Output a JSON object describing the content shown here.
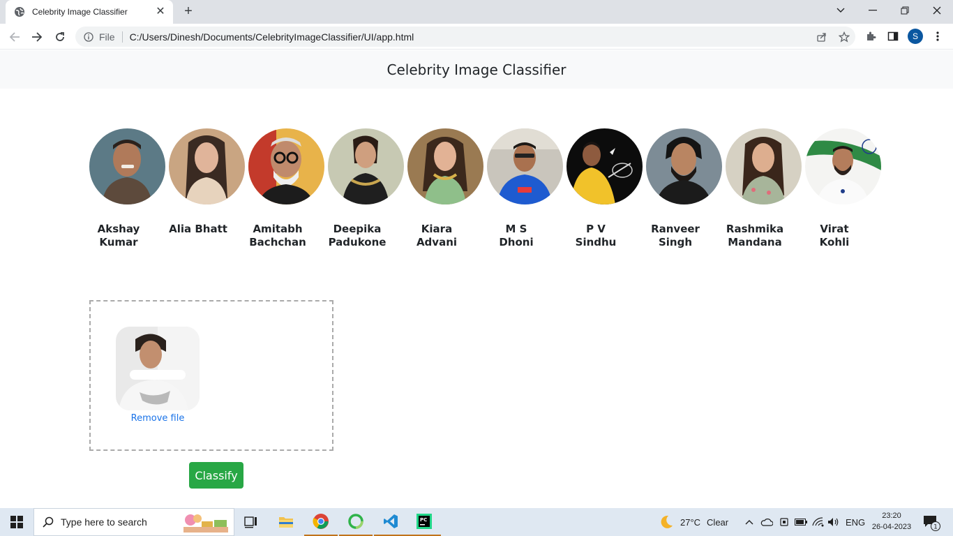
{
  "browser": {
    "tab_title": "Celebrity Image Classifier",
    "tab_close": "✕",
    "new_tab": "+",
    "scheme_label": "File",
    "url": "C:/Users/Dinesh/Documents/CelebrityImageClassifier/UI/app.html",
    "profile_initial": "S"
  },
  "page": {
    "brand": "Celebrity Image Classifier",
    "celebrities": [
      {
        "name": "Akshay Kumar"
      },
      {
        "name": "Alia Bhatt"
      },
      {
        "name": "Amitabh Bachchan"
      },
      {
        "name": "Deepika Padukone"
      },
      {
        "name": "Kiara Advani"
      },
      {
        "name": "M S Dhoni"
      },
      {
        "name": "P V Sindhu"
      },
      {
        "name": "Ranveer Singh"
      },
      {
        "name": "Rashmika Mandana"
      },
      {
        "name": "Virat Kohli"
      }
    ],
    "dropzone": {
      "remove_label": "Remove file"
    },
    "classify_label": "Classify"
  },
  "taskbar": {
    "search_placeholder": "Type here to search",
    "weather_temp": "27°C",
    "weather_desc": "Clear",
    "language": "ENG",
    "time": "23:20",
    "date": "26-04-2023",
    "notification_count": "1"
  }
}
